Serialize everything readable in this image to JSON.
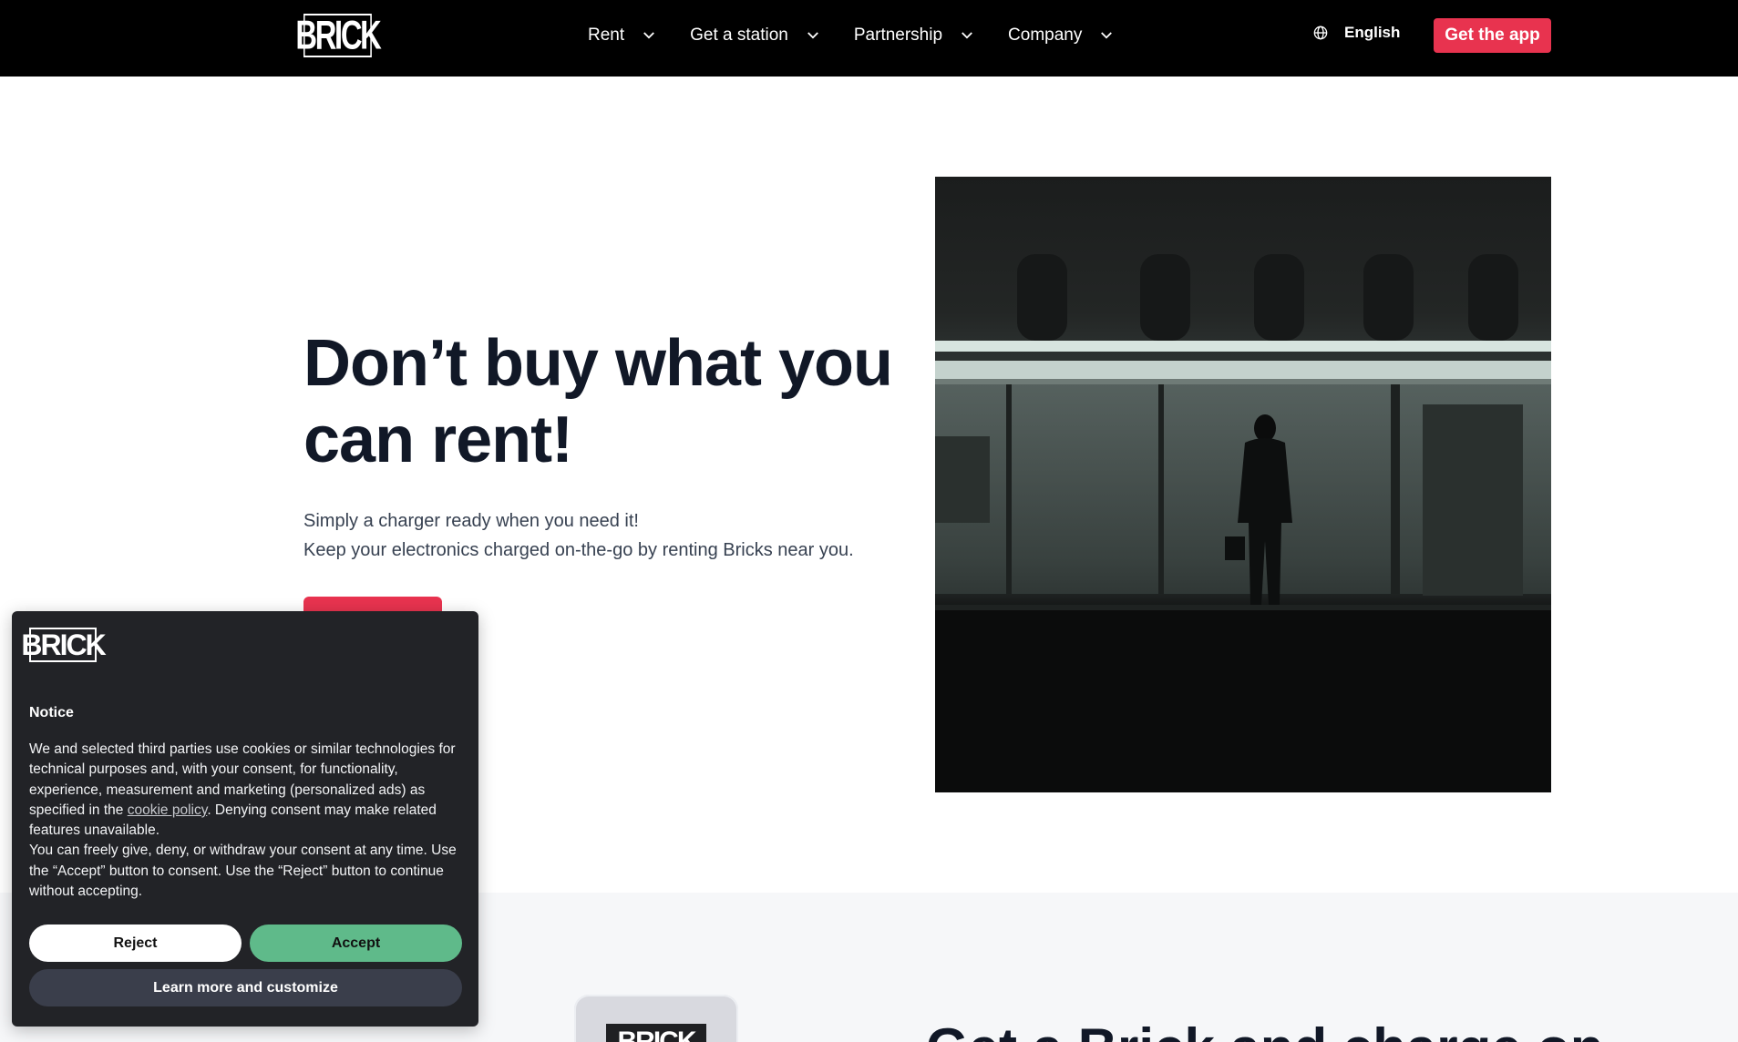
{
  "header": {
    "logo_text": "BRICK",
    "nav": [
      {
        "label": "Rent"
      },
      {
        "label": "Get a station"
      },
      {
        "label": "Partnership"
      },
      {
        "label": "Company"
      }
    ],
    "language": "English",
    "cta_label": "Get the app"
  },
  "hero": {
    "title_line1": "Don’t buy what you",
    "title_line2": "can rent!",
    "subtitle_line1": "Simply a charger ready when you need it!",
    "subtitle_line2": "Keep your electronics charged on-the-go by renting Bricks near you."
  },
  "band": {
    "title": "Get a Brick and charge on",
    "device_logo": "BRICK"
  },
  "cookie": {
    "logo_text": "BRICK",
    "heading": "Notice",
    "text_part1": "We and selected third parties use cookies or similar technologies for technical purposes and, with your consent, for functionality, experience, measurement and marketing (personalized ads) as specified in the ",
    "link_text": "cookie policy",
    "text_part2": ". Denying consent may make related features unavailable.",
    "text_para2": "You can freely give, deny, or withdraw your consent at any time. Use the “Accept” button to consent. Use the “Reject” button to continue without accepting.",
    "reject_label": "Reject",
    "accept_label": "Accept",
    "learn_label": "Learn more and customize"
  },
  "colors": {
    "brand_red": "#e8334f",
    "accept_green": "#5fba8a",
    "banner_bg": "#222327"
  }
}
